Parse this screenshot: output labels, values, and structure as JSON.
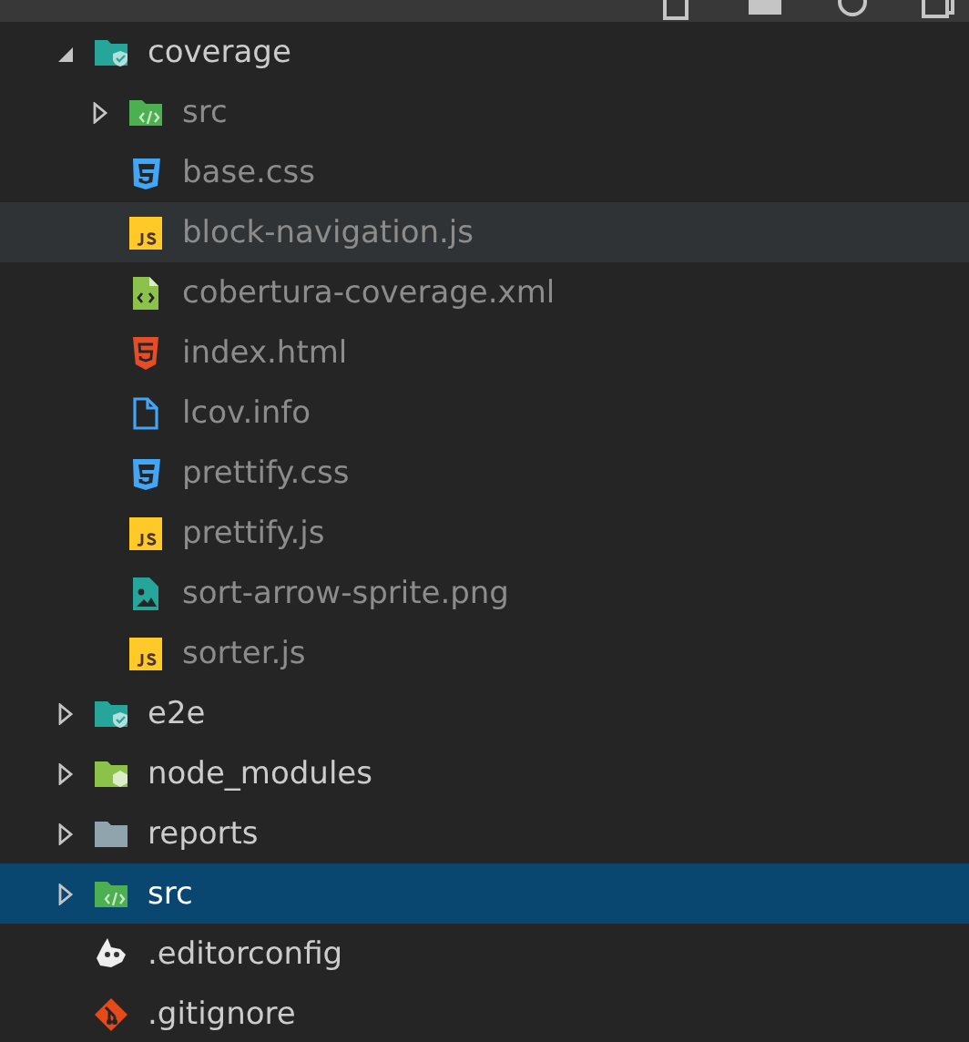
{
  "tree": [
    {
      "label": "coverage",
      "kind": "folder-shield",
      "expanded": true,
      "selected": false,
      "hovered": false,
      "dimmed": false,
      "children": [
        {
          "label": "src",
          "kind": "folder-code",
          "expanded": false,
          "selected": false,
          "hovered": false,
          "dimmed": true
        },
        {
          "label": "base.css",
          "kind": "css",
          "selected": false,
          "hovered": false,
          "dimmed": true
        },
        {
          "label": "block-navigation.js",
          "kind": "js",
          "selected": false,
          "hovered": true,
          "dimmed": true
        },
        {
          "label": "cobertura-coverage.xml",
          "kind": "xml",
          "selected": false,
          "hovered": false,
          "dimmed": true
        },
        {
          "label": "index.html",
          "kind": "html",
          "selected": false,
          "hovered": false,
          "dimmed": true
        },
        {
          "label": "lcov.info",
          "kind": "file",
          "selected": false,
          "hovered": false,
          "dimmed": true
        },
        {
          "label": "prettify.css",
          "kind": "css",
          "selected": false,
          "hovered": false,
          "dimmed": true
        },
        {
          "label": "prettify.js",
          "kind": "js",
          "selected": false,
          "hovered": false,
          "dimmed": true
        },
        {
          "label": "sort-arrow-sprite.png",
          "kind": "image",
          "selected": false,
          "hovered": false,
          "dimmed": true
        },
        {
          "label": "sorter.js",
          "kind": "js",
          "selected": false,
          "hovered": false,
          "dimmed": true
        }
      ]
    },
    {
      "label": "e2e",
      "kind": "folder-shield",
      "expanded": false,
      "selected": false,
      "hovered": false,
      "dimmed": false
    },
    {
      "label": "node_modules",
      "kind": "folder-node",
      "expanded": false,
      "selected": false,
      "hovered": false,
      "dimmed": false
    },
    {
      "label": "reports",
      "kind": "folder",
      "expanded": false,
      "selected": false,
      "hovered": false,
      "dimmed": false
    },
    {
      "label": "src",
      "kind": "folder-code",
      "expanded": false,
      "selected": true,
      "hovered": false,
      "dimmed": false
    },
    {
      "label": ".editorconfig",
      "kind": "config",
      "selected": false,
      "hovered": false,
      "dimmed": false
    },
    {
      "label": ".gitignore",
      "kind": "git",
      "selected": false,
      "hovered": false,
      "dimmed": false
    }
  ]
}
